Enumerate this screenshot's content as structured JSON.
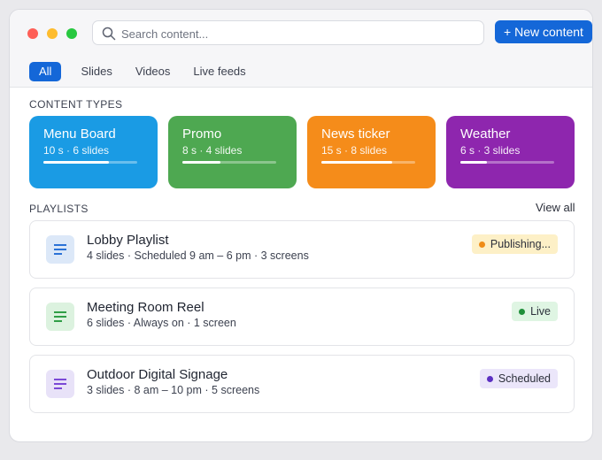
{
  "search": {
    "placeholder": "Search content..."
  },
  "header": {
    "new_button": "+ New content"
  },
  "tabs": [
    {
      "label": "All",
      "active": true
    },
    {
      "label": "Slides"
    },
    {
      "label": "Videos"
    },
    {
      "label": "Live feeds"
    }
  ],
  "content_types": {
    "heading": "CONTENT TYPES",
    "items": [
      {
        "title": "Menu Board",
        "meta": "10 s · 6 slides",
        "color": "#1a9be4",
        "progress": 0.7
      },
      {
        "title": "Promo",
        "meta": "8 s · 4 slides",
        "color": "#4ea851",
        "progress": 0.41
      },
      {
        "title": "News ticker",
        "meta": "15 s · 8 slides",
        "color": "#f58c1a",
        "progress": 0.75
      },
      {
        "title": "Weather",
        "meta": "6 s · 3 slides",
        "color": "#8e26ae",
        "progress": 0.28
      }
    ]
  },
  "playlists": {
    "heading": "PLAYLISTS",
    "view_all": "View all",
    "items": [
      {
        "title": "Lobby Playlist",
        "meta": "4 slides · Scheduled 9 am – 6 pm · 3 screens",
        "status": "Publishing...",
        "status_bg": "#fdf0c7",
        "status_dot": "#ef8c17",
        "icon": "playlist-icon",
        "icon_color": "#2b72d6",
        "icon_bg": "#dce8f8"
      },
      {
        "title": "Meeting Room Reel",
        "meta": "6 slides · Always on · 1 screen",
        "status": "Live",
        "status_bg": "#dff5e3",
        "status_dot": "#1f8f3a",
        "icon": "playlist-icon",
        "icon_color": "#2f9e46",
        "icon_bg": "#dcf2df"
      },
      {
        "title": "Outdoor Digital Signage",
        "meta": "3 slides · 8 am – 10 pm · 5 screens",
        "status": "Scheduled",
        "status_bg": "#ebe6fa",
        "status_dot": "#5b2fc2",
        "icon": "playlist-icon",
        "icon_color": "#7b49d6",
        "icon_bg": "#e8e2f8"
      }
    ]
  }
}
